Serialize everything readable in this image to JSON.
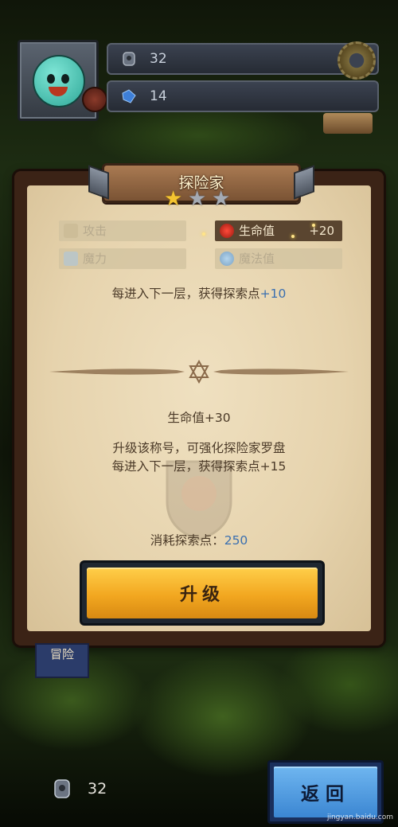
{
  "hud": {
    "keys_count": "32",
    "gems_count": "14"
  },
  "modal": {
    "title": "探险家",
    "stars_filled": 1,
    "stars_total": 3,
    "stats": {
      "attack_label": "攻击",
      "hp_label": "生命值",
      "hp_bonus": "+20",
      "magic_label": "魔力",
      "mana_label": "魔法值"
    },
    "current_effect_text": "每进入下一层，获得探索点",
    "current_effect_value": "+10",
    "next_level_hp": "生命值+30",
    "upgrade_desc_line1": "升级该称号，可强化探险家罗盘",
    "upgrade_desc_line2": "每进入下一层，获得探索点+15",
    "cost_label": "消耗探索点：",
    "cost_value": "250",
    "upgrade_button": "升级"
  },
  "background": {
    "adventure_flag": "冒险"
  },
  "footer": {
    "points_count": "32",
    "back_button": "返回"
  },
  "watermark": "jingyan.baidu.com"
}
